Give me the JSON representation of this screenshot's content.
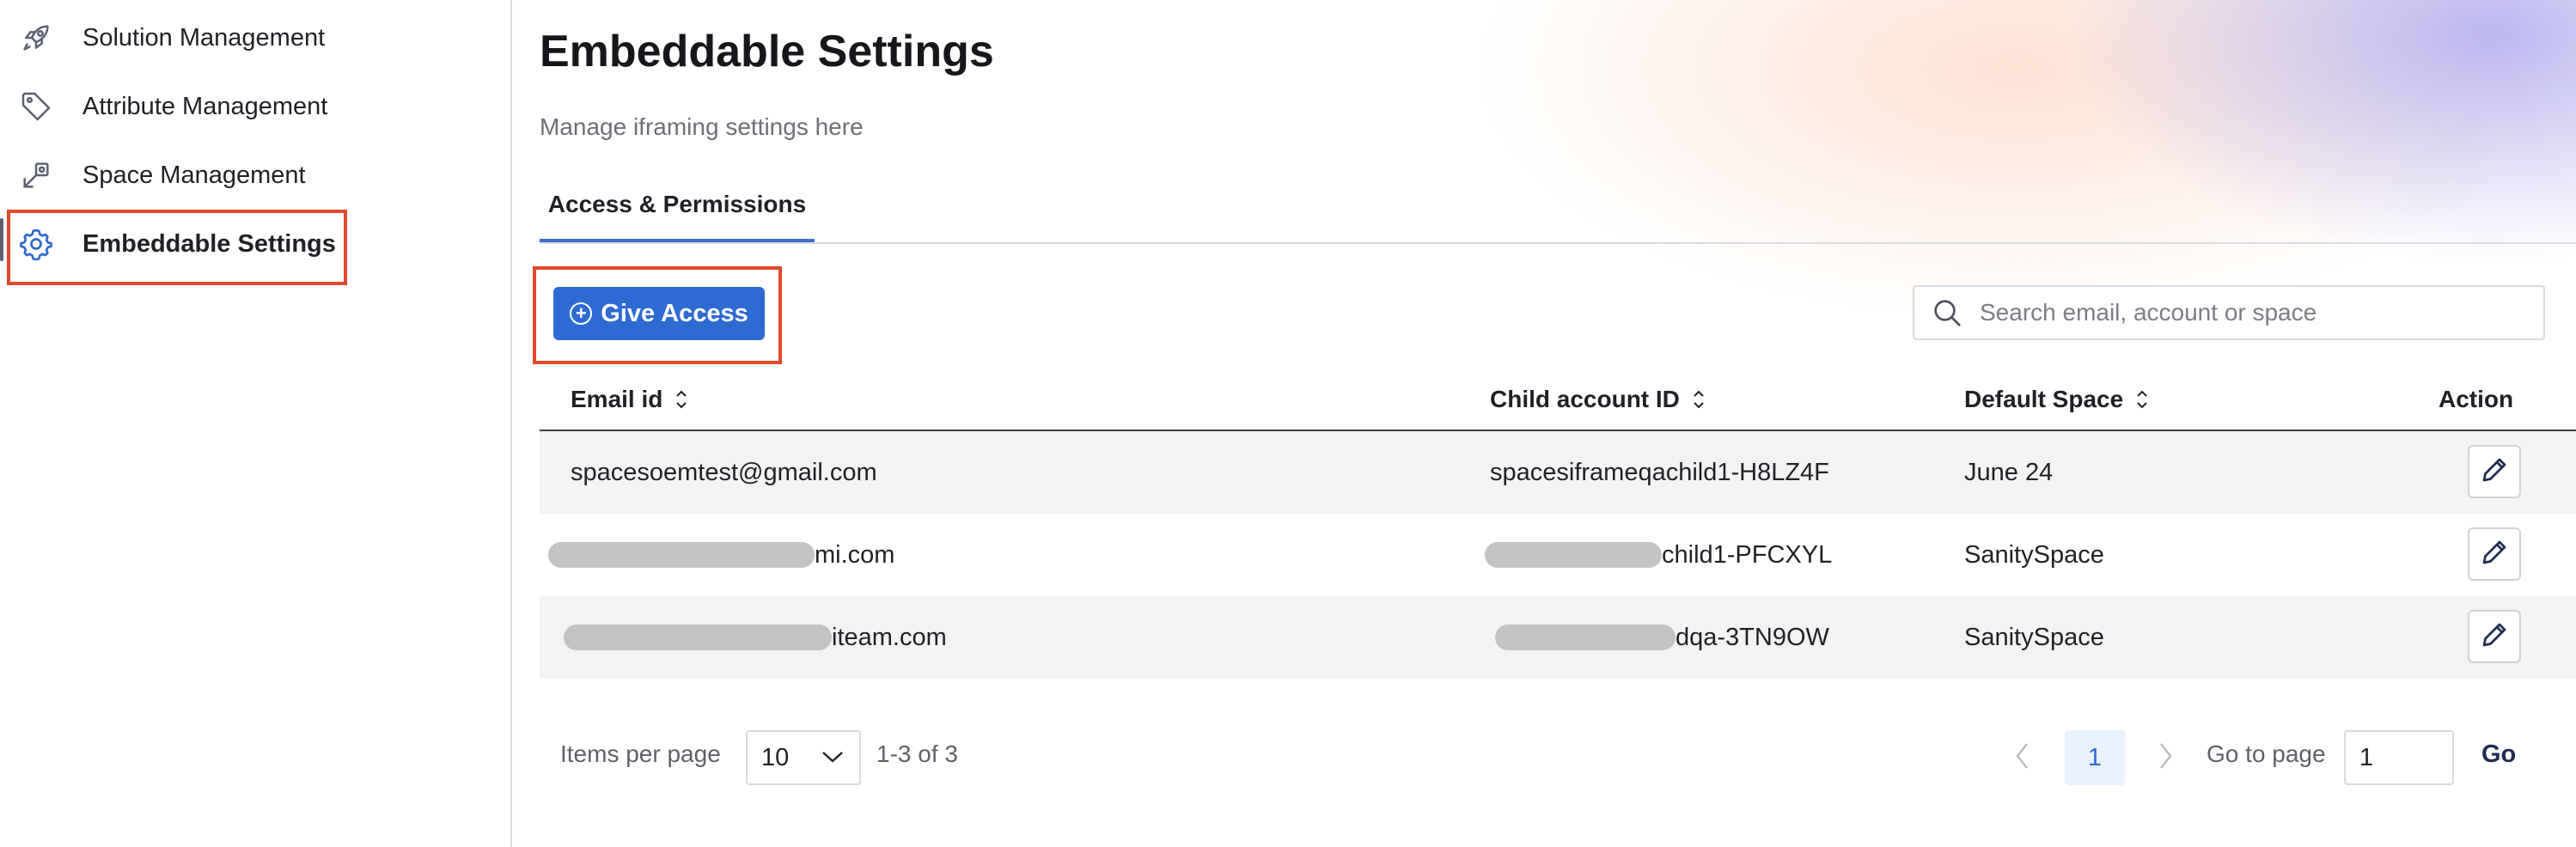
{
  "sidebar": {
    "items": [
      {
        "label": "Solution Management",
        "icon": "rocket-icon"
      },
      {
        "label": "Attribute Management",
        "icon": "tag-icon"
      },
      {
        "label": "Space Management",
        "icon": "space-icon"
      },
      {
        "label": "Embeddable Settings",
        "icon": "gear-icon",
        "active": true
      }
    ]
  },
  "header": {
    "title": "Embeddable Settings",
    "subtitle": "Manage iframing settings here"
  },
  "tabs": [
    {
      "label": "Access & Permissions",
      "active": true
    }
  ],
  "toolbar": {
    "give_access_label": "Give Access",
    "search_placeholder": "Search email, account or space"
  },
  "table": {
    "columns": [
      "Email id",
      "Child account ID",
      "Default Space",
      "Action"
    ],
    "rows": [
      {
        "email": "spacesoemtest@gmail.com",
        "child_account": "spacesiframeqachild1-H8LZ4F",
        "default_space": "June 24"
      },
      {
        "email": "mi.com",
        "child_account": "child1-PFCXYL",
        "default_space": "SanitySpace"
      },
      {
        "email": "iteam.com",
        "child_account": "dqa-3TN9OW",
        "default_space": "SanitySpace"
      }
    ]
  },
  "pagination": {
    "items_per_page_label": "Items per page",
    "items_per_page_value": "10",
    "range_text": "1-3 of 3",
    "current_page": "1",
    "goto_label": "Go to page",
    "goto_value": "1",
    "go_label": "Go"
  },
  "colors": {
    "accent": "#2e6ad1",
    "highlight": "#e04a2c"
  }
}
